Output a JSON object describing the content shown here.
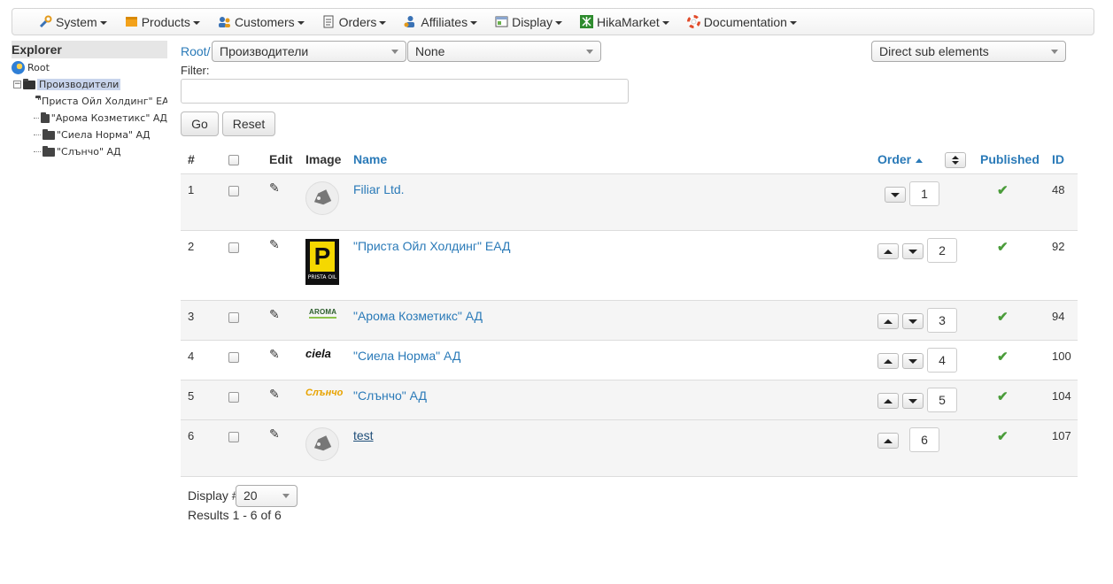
{
  "menu": [
    {
      "label": "System",
      "icon": "tools-icon"
    },
    {
      "label": "Products",
      "icon": "box-icon"
    },
    {
      "label": "Customers",
      "icon": "users-icon"
    },
    {
      "label": "Orders",
      "icon": "document-icon"
    },
    {
      "label": "Affiliates",
      "icon": "affiliates-icon"
    },
    {
      "label": "Display",
      "icon": "display-icon"
    },
    {
      "label": "HikaMarket",
      "icon": "hikamarket-icon"
    },
    {
      "label": "Documentation",
      "icon": "lifebuoy-icon"
    }
  ],
  "explorer": {
    "title": "Explorer",
    "root": "Root",
    "selected": "Производители",
    "children": [
      "\"Приста Ойл Холдинг\" ЕАД",
      "\"Арома Козметикс\" АД",
      "\"Сиела Норма\" АД",
      "\"Слънчо\" АД"
    ]
  },
  "filters": {
    "root_link": "Root/",
    "category_select": "Производители",
    "second_select": "None",
    "scope_select": "Direct sub elements",
    "filter_label": "Filter:",
    "filter_value": "",
    "go_label": "Go",
    "reset_label": "Reset"
  },
  "table": {
    "headers": {
      "num": "#",
      "edit": "Edit",
      "image": "Image",
      "name": "Name",
      "order": "Order",
      "published": "Published",
      "id": "ID"
    },
    "rows": [
      {
        "num": "1",
        "name": "Filiar Ltd.",
        "image": "tag-image",
        "order": "1",
        "up": false,
        "down": true,
        "published": true,
        "id": "48"
      },
      {
        "num": "2",
        "name": "\"Приста Ойл Холдинг\" ЕАД",
        "image": "prista-logo",
        "order": "2",
        "up": true,
        "down": true,
        "published": true,
        "id": "92"
      },
      {
        "num": "3",
        "name": "\"Арома Козметикс\" АД",
        "image": "aroma-logo",
        "order": "3",
        "up": true,
        "down": true,
        "published": true,
        "id": "94"
      },
      {
        "num": "4",
        "name": "\"Сиела Норма\" АД",
        "image": "ciela-logo",
        "order": "4",
        "up": true,
        "down": true,
        "published": true,
        "id": "100"
      },
      {
        "num": "5",
        "name": "\"Слънчо\" АД",
        "image": "sun-logo",
        "order": "5",
        "up": true,
        "down": true,
        "published": true,
        "id": "104"
      },
      {
        "num": "6",
        "name": "test",
        "image": "tag-image",
        "order": "6",
        "up": true,
        "down": false,
        "published": true,
        "id": "107"
      }
    ]
  },
  "logos": {
    "prista_letter": "P",
    "prista_caption": "PRISTA OIL",
    "aroma_text": "AROMA",
    "ciela_text": "ciela",
    "sun_text": "Слънчо"
  },
  "footer": {
    "display_label": "Display #",
    "display_value": "20",
    "results_text": "Results 1 - 6 of 6"
  },
  "colors": {
    "link": "#2a7ab8",
    "check": "#4a9c3a",
    "row_alt": "#f5f5f5"
  }
}
